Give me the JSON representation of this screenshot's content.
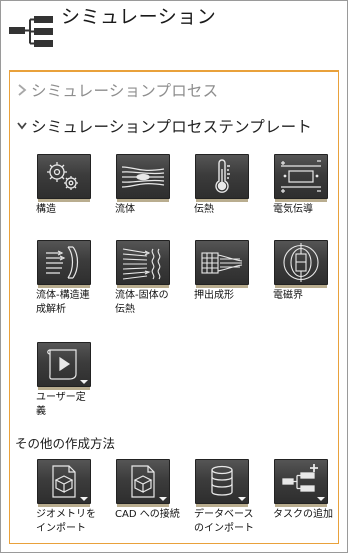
{
  "header": {
    "title": "シミュレーション",
    "icon": "hierarchy-icon"
  },
  "panel": {
    "sections": [
      {
        "label": "シミュレーションプロセス",
        "expanded": false
      },
      {
        "label": "シミュレーションプロセステンプレート",
        "expanded": true
      }
    ],
    "templates": [
      {
        "label": "構造",
        "icon": "gears-icon"
      },
      {
        "label": "流体",
        "icon": "flow-lines-icon"
      },
      {
        "label": "伝熱",
        "icon": "thermometer-icon"
      },
      {
        "label": "電気伝導",
        "icon": "electric-conduction-icon"
      },
      {
        "label": "流体-構造連\n成解析",
        "icon": "fluid-structure-icon"
      },
      {
        "label": "流体-固体の\n伝熱",
        "icon": "fluid-solid-heat-icon"
      },
      {
        "label": "押出成形",
        "icon": "extrusion-icon"
      },
      {
        "label": "電磁界",
        "icon": "magnet-field-icon"
      },
      {
        "label": "ユーザー定\n義",
        "icon": "user-defined-icon"
      }
    ],
    "other_title": "その他の作成方法",
    "other_methods": [
      {
        "label": "ジオメトリを\nインポート",
        "icon": "geometry-import-icon"
      },
      {
        "label": "CAD への接続",
        "icon": "cad-connect-icon"
      },
      {
        "label": "データベース\nのインポート",
        "icon": "database-import-icon"
      },
      {
        "label": "タスクの追加",
        "icon": "add-task-icon"
      }
    ]
  },
  "colors": {
    "panel_border": "#e9a13b",
    "tile_bg": "#3c3c3c",
    "tile_underline": "#b9ad8f"
  }
}
